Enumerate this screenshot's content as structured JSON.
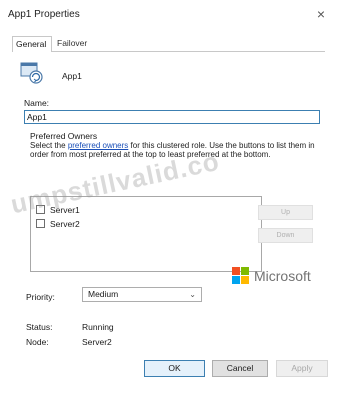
{
  "window": {
    "title": "App1 Properties",
    "close_glyph": "×"
  },
  "tabs": [
    {
      "label": "General",
      "selected": true
    },
    {
      "label": "Failover",
      "selected": false
    }
  ],
  "role": {
    "icon": "clustered-role-icon",
    "name": "App1"
  },
  "name_field": {
    "label": "Name:",
    "value": "App1"
  },
  "preferred_owners": {
    "title": "Preferred Owners",
    "desc_before": "Select the ",
    "desc_link": "preferred owners",
    "desc_after": " for this clustered role. Use the buttons to list them in order from most preferred at the top to least preferred at the bottom.",
    "owners": [
      {
        "label": "Server1",
        "checked": false
      },
      {
        "label": "Server2",
        "checked": false
      }
    ],
    "up_label": "Up",
    "down_label": "Down"
  },
  "overlay": {
    "watermark": "umpstillvalid.co",
    "microsoft_text": "Microsoft",
    "microsoft_colors": [
      "#f25022",
      "#7fba00",
      "#00a4ef",
      "#ffb900"
    ]
  },
  "priority": {
    "label": "Priority:",
    "value": "Medium"
  },
  "status": {
    "label": "Status:",
    "value": "Running"
  },
  "node": {
    "label": "Node:",
    "value": "Server2"
  },
  "buttons": {
    "ok": "OK",
    "cancel": "Cancel",
    "apply": "Apply"
  },
  "colors": {
    "accent": "#3c7fb1",
    "link": "#1a4fb8"
  }
}
